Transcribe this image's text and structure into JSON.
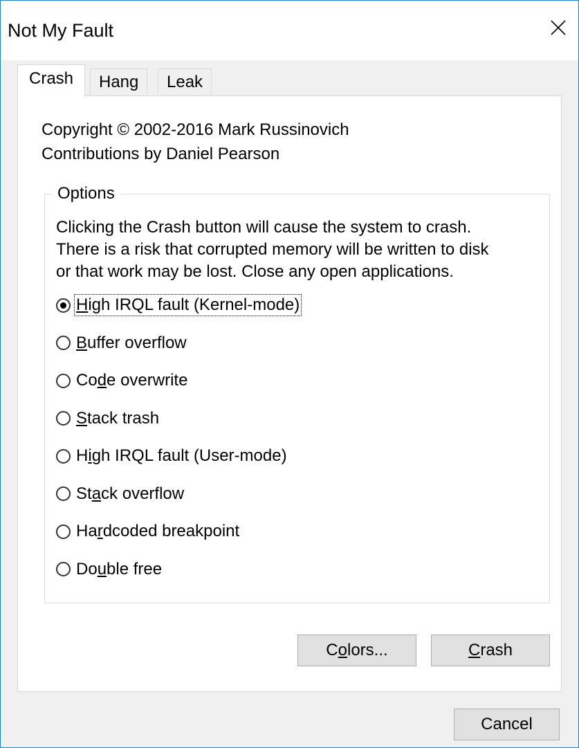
{
  "window": {
    "title": "Not My Fault",
    "close_icon": "close-icon"
  },
  "tabs": [
    {
      "label": "Crash",
      "active": true
    },
    {
      "label": "Hang",
      "active": false
    },
    {
      "label": "Leak",
      "active": false
    }
  ],
  "panel": {
    "copyright": "Copyright © 2002-2016 Mark Russinovich",
    "contributions": "Contributions by Daniel Pearson",
    "options_title": "Options",
    "description_lines": [
      "Clicking the Crash button will cause the system to crash.",
      "There is a risk that corrupted memory will be written to disk",
      "or that work may be lost. Close any open applications."
    ],
    "options": [
      {
        "pre": "",
        "accel": "H",
        "post": "igh IRQL fault (Kernel-mode)",
        "checked": true,
        "focused": true
      },
      {
        "pre": "",
        "accel": "B",
        "post": "uffer overflow",
        "checked": false
      },
      {
        "pre": "Co",
        "accel": "d",
        "post": "e overwrite",
        "checked": false
      },
      {
        "pre": "",
        "accel": "S",
        "post": "tack trash",
        "checked": false
      },
      {
        "pre": "H",
        "accel": "i",
        "post": "gh IRQL fault (User-mode)",
        "checked": false
      },
      {
        "pre": "St",
        "accel": "a",
        "post": "ck overflow",
        "checked": false
      },
      {
        "pre": "Ha",
        "accel": "r",
        "post": "dcoded breakpoint",
        "checked": false
      },
      {
        "pre": "Do",
        "accel": "u",
        "post": "ble free",
        "checked": false
      }
    ],
    "colors_button": {
      "pre": "C",
      "accel": "o",
      "post": "lors..."
    },
    "crash_button": {
      "pre": "",
      "accel": "C",
      "post": "rash"
    }
  },
  "cancel_button": "Cancel"
}
